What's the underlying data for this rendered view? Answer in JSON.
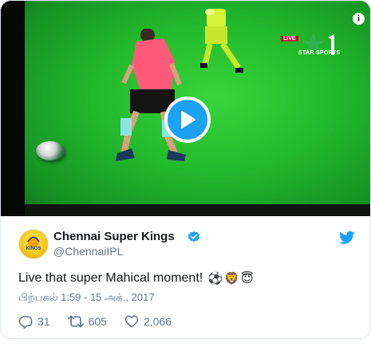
{
  "tweet": {
    "display_name": "Chennai Super Kings",
    "handle": "@ChennaiIPL",
    "text": "Live that super Mahical moment!",
    "emojis": [
      "⚽",
      "🦁",
      "😇"
    ],
    "timestamp": "பிற்பகல் 1:59 - 15 அக்., 2017",
    "replies": "31",
    "retweets": "605",
    "likes": "2,066"
  },
  "media": {
    "broadcaster_live": "LIVE",
    "broadcaster_name": "STAR SPORTS",
    "channel_number": "1"
  },
  "avatar": {
    "label": "KINGS"
  },
  "colors": {
    "twitter_blue": "#1da1f2",
    "text_primary": "#14171a",
    "text_secondary": "#657786",
    "border": "#e1e8ed",
    "pitch_green": "#22b82c"
  },
  "icons": {
    "play": "play-icon",
    "info": "info-icon",
    "verified": "verified-icon",
    "twitter": "twitter-bird-icon",
    "reply": "reply-icon",
    "retweet": "retweet-icon",
    "like": "heart-icon"
  }
}
